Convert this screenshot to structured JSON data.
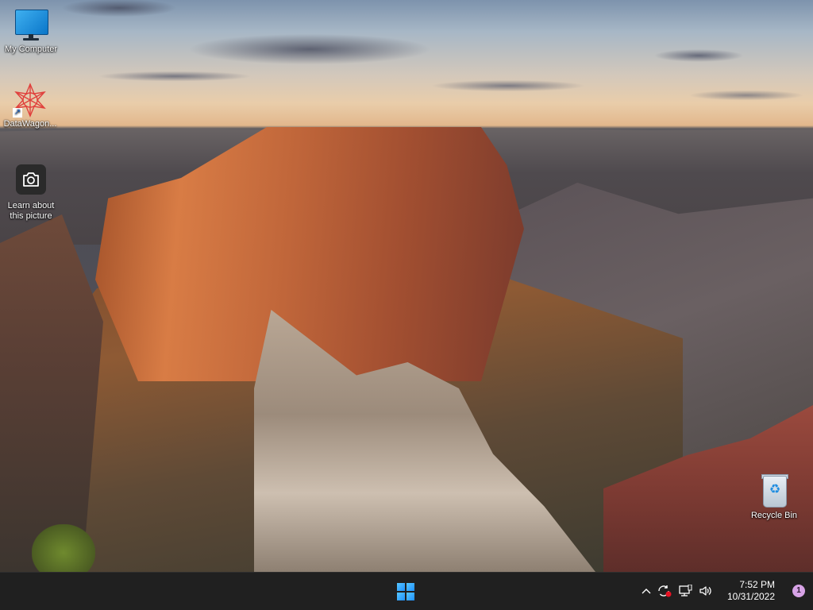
{
  "desktop": {
    "icons": [
      {
        "label": "My Computer",
        "icon": "monitor-icon"
      },
      {
        "label": "DataWagon...",
        "icon": "datawagon-logo-icon"
      },
      {
        "label": "Learn about this picture",
        "icon": "camera-icon"
      },
      {
        "label": "Recycle Bin",
        "icon": "recycle-bin-icon"
      }
    ]
  },
  "taskbar": {
    "start_icon": "windows-logo-icon",
    "tray": {
      "overflow_icon": "chevron-up-icon",
      "sync_icon": "sync-error-icon",
      "network_icon": "network-icon",
      "volume_icon": "volume-icon",
      "time": "7:52 PM",
      "date": "10/31/2022",
      "notification_count": "1"
    }
  },
  "colors": {
    "taskbar_bg": "#202020",
    "accent": "#1e90ff",
    "badge": "#d7a3e6"
  }
}
